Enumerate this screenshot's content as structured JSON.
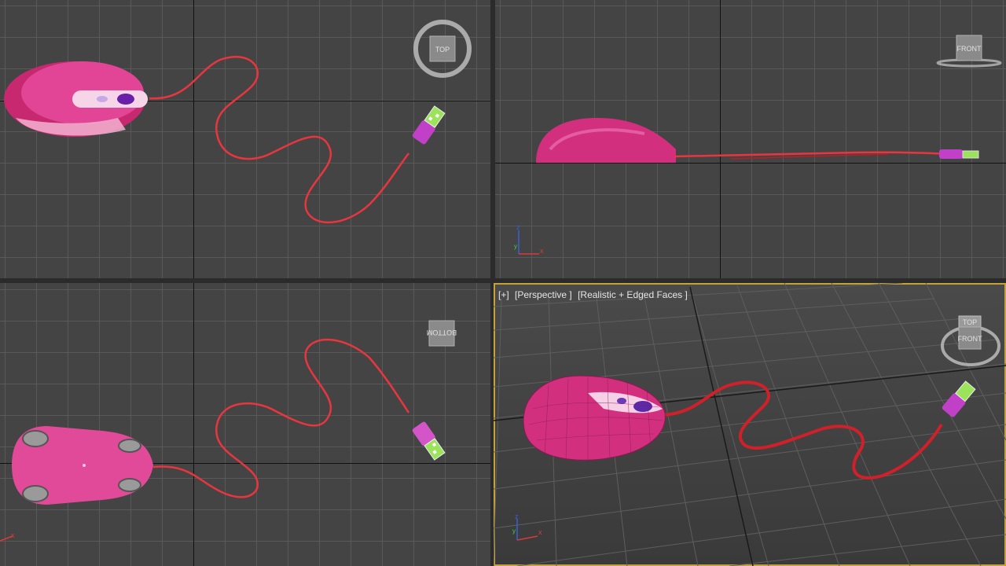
{
  "viewports": {
    "top": {
      "cube_label": "TOP"
    },
    "front": {
      "cube_label": "FRONT"
    },
    "bottom": {
      "cube_label": "BOTTOM"
    },
    "perspective": {
      "label_parts": [
        "[+]",
        "[Perspective ]",
        "[Realistic + Edged Faces ]"
      ],
      "cube_label": "FRONT",
      "cube_top_label": "TOP"
    }
  },
  "axis_labels": {
    "x": "x",
    "y": "y",
    "z": "z"
  },
  "icons": [
    "viewcube-icon",
    "axis-tripod-icon"
  ],
  "colors": {
    "viewport_bg": "#444444",
    "grid": "#595959",
    "active_border": "#c4a237",
    "mouse_body": "#d2307f",
    "cable": "#e8363f",
    "connector": "#c040c8",
    "usb_tip": "#9be35a"
  }
}
